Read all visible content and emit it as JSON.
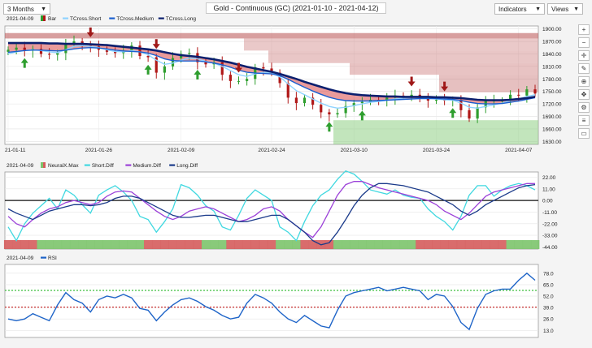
{
  "toolbar": {
    "range_label": "3 Months",
    "title": "Gold - Continuous (GC) (2021-01-10 - 2021-04-12)",
    "indicators_label": "Indicators",
    "views_label": "Views"
  },
  "side_tools": [
    "plus-icon",
    "minus-icon",
    "crosshair-icon",
    "draw-icon",
    "zoom-icon",
    "pan-icon",
    "settings-icon",
    "list-icon",
    "comment-icon"
  ],
  "colors": {
    "bar_up": "#2e9e2e",
    "bar_down": "#b01818",
    "tcross_short": "#8fd3ff",
    "tcross_medium": "#1a5fd0",
    "tcross_long": "#0b1f6e",
    "short_diff": "#40d8e0",
    "medium_diff": "#9b40d8",
    "long_diff": "#1a3a8a",
    "rsi": "#1e64c8",
    "up_arrow": "#2e9e2e",
    "down_arrow": "#a01818"
  },
  "chart_data": [
    {
      "type": "line",
      "panel": "price",
      "date_label": "2021-04-09",
      "legend": [
        "Bar",
        "TCross.Short",
        "TCross.Medium",
        "TCross.Long"
      ],
      "x": [
        "2021-01-11",
        "2021-01-12",
        "2021-01-13",
        "2021-01-14",
        "2021-01-15",
        "2021-01-18",
        "2021-01-19",
        "2021-01-20",
        "2021-01-21",
        "2021-01-22",
        "2021-01-25",
        "2021-01-26",
        "2021-01-27",
        "2021-01-28",
        "2021-01-29",
        "2021-02-01",
        "2021-02-02",
        "2021-02-03",
        "2021-02-04",
        "2021-02-05",
        "2021-02-08",
        "2021-02-09",
        "2021-02-10",
        "2021-02-11",
        "2021-02-12",
        "2021-02-15",
        "2021-02-16",
        "2021-02-17",
        "2021-02-18",
        "2021-02-19",
        "2021-02-22",
        "2021-02-23",
        "2021-02-24",
        "2021-02-25",
        "2021-02-26",
        "2021-03-01",
        "2021-03-02",
        "2021-03-03",
        "2021-03-04",
        "2021-03-05",
        "2021-03-08",
        "2021-03-09",
        "2021-03-10",
        "2021-03-11",
        "2021-03-12",
        "2021-03-15",
        "2021-03-16",
        "2021-03-17",
        "2021-03-18",
        "2021-03-19",
        "2021-03-22",
        "2021-03-23",
        "2021-03-24",
        "2021-03-25",
        "2021-03-26",
        "2021-03-29",
        "2021-03-30",
        "2021-03-31",
        "2021-04-01",
        "2021-04-02",
        "2021-04-05",
        "2021-04-06",
        "2021-04-07",
        "2021-04-08",
        "2021-04-09"
      ],
      "x_ticks": [
        "21-01-11",
        "2021-01-26",
        "2021-02-09",
        "2021-02-24",
        "2021-03-10",
        "2021-03-24",
        "2021-04-07"
      ],
      "x_tick_index": [
        0,
        11,
        21,
        32,
        42,
        52,
        62
      ],
      "close": [
        1850,
        1855,
        1848,
        1852,
        1840,
        1838,
        1842,
        1865,
        1870,
        1860,
        1858,
        1850,
        1845,
        1842,
        1848,
        1860,
        1835,
        1832,
        1795,
        1810,
        1830,
        1840,
        1842,
        1820,
        1815,
        1820,
        1790,
        1775,
        1775,
        1780,
        1808,
        1805,
        1795,
        1770,
        1735,
        1722,
        1735,
        1718,
        1700,
        1695,
        1698,
        1715,
        1722,
        1725,
        1730,
        1728,
        1735,
        1740,
        1738,
        1742,
        1738,
        1728,
        1730,
        1728,
        1730,
        1705,
        1685,
        1712,
        1728,
        1728,
        1728,
        1742,
        1740,
        1755,
        1745
      ],
      "series": [
        {
          "name": "TCross.Short",
          "values": [
            1840,
            1845,
            1848,
            1850,
            1848,
            1845,
            1843,
            1850,
            1858,
            1860,
            1858,
            1855,
            1850,
            1846,
            1845,
            1848,
            1845,
            1838,
            1825,
            1815,
            1818,
            1825,
            1830,
            1828,
            1822,
            1818,
            1810,
            1800,
            1790,
            1786,
            1792,
            1796,
            1795,
            1785,
            1768,
            1752,
            1742,
            1732,
            1722,
            1714,
            1710,
            1712,
            1716,
            1720,
            1724,
            1726,
            1729,
            1732,
            1734,
            1736,
            1736,
            1734,
            1732,
            1730,
            1729,
            1722,
            1712,
            1710,
            1714,
            1718,
            1722,
            1728,
            1732,
            1738,
            1742
          ]
        },
        {
          "name": "TCross.Medium",
          "values": [
            1844,
            1846,
            1848,
            1849,
            1849,
            1848,
            1847,
            1849,
            1852,
            1854,
            1855,
            1854,
            1852,
            1849,
            1847,
            1846,
            1845,
            1842,
            1836,
            1828,
            1824,
            1823,
            1823,
            1823,
            1821,
            1818,
            1814,
            1808,
            1801,
            1796,
            1794,
            1793,
            1792,
            1788,
            1779,
            1769,
            1760,
            1751,
            1743,
            1736,
            1731,
            1728,
            1727,
            1727,
            1727,
            1728,
            1729,
            1730,
            1731,
            1732,
            1733,
            1733,
            1733,
            1732,
            1731,
            1728,
            1724,
            1721,
            1720,
            1720,
            1721,
            1724,
            1727,
            1731,
            1735
          ]
        },
        {
          "name": "TCross.Long",
          "values": [
            1866,
            1866,
            1866,
            1866,
            1866,
            1865,
            1865,
            1864,
            1864,
            1864,
            1863,
            1862,
            1861,
            1859,
            1857,
            1855,
            1853,
            1851,
            1848,
            1844,
            1840,
            1837,
            1835,
            1833,
            1830,
            1827,
            1823,
            1819,
            1814,
            1809,
            1805,
            1801,
            1797,
            1792,
            1786,
            1780,
            1773,
            1767,
            1761,
            1755,
            1750,
            1746,
            1743,
            1741,
            1740,
            1739,
            1738,
            1738,
            1737,
            1737,
            1737,
            1737,
            1736,
            1736,
            1735,
            1734,
            1732,
            1730,
            1729,
            1729,
            1729,
            1730,
            1732,
            1734,
            1737
          ]
        }
      ],
      "y_ticks": [
        1900,
        1870,
        1840,
        1810,
        1780,
        1750,
        1720,
        1690,
        1660,
        1630
      ],
      "y_tick_labels": [
        "1900.00",
        "1870.00",
        "1840.00",
        "1810.00",
        "1780.00",
        "1750.00",
        "1720.00",
        "1690.00",
        "1660.00",
        "1630.00"
      ],
      "ylim": [
        1623,
        1907
      ],
      "down_arrows_at": [
        10,
        18,
        28,
        49,
        53
      ],
      "up_arrows_at": [
        2,
        17,
        23,
        39,
        43,
        54
      ]
    },
    {
      "type": "line",
      "panel": "neurals",
      "date_label": "2021-04-09",
      "legend": [
        "NeuralX.Max",
        "Short.Diff",
        "Medium.Diff",
        "Long.Diff"
      ],
      "series": [
        {
          "name": "Short.Diff",
          "values": [
            -25,
            -38,
            -22,
            -12,
            -5,
            2,
            -8,
            10,
            5,
            -4,
            -12,
            5,
            10,
            14,
            8,
            0,
            -15,
            -18,
            -30,
            -20,
            -8,
            15,
            12,
            5,
            -5,
            -10,
            -25,
            -28,
            -14,
            2,
            10,
            5,
            0,
            -25,
            -30,
            -38,
            -20,
            -5,
            5,
            10,
            20,
            28,
            25,
            18,
            10,
            8,
            6,
            10,
            5,
            3,
            2,
            -8,
            -15,
            -20,
            -28,
            -15,
            5,
            14,
            14,
            4,
            10,
            14,
            16,
            14,
            10
          ]
        },
        {
          "name": "Medium.Diff",
          "values": [
            -15,
            -22,
            -25,
            -18,
            -12,
            -8,
            -6,
            -2,
            0,
            -2,
            -4,
            -2,
            4,
            8,
            9,
            8,
            2,
            -4,
            -10,
            -15,
            -18,
            -15,
            -10,
            -8,
            -6,
            -8,
            -12,
            -16,
            -20,
            -18,
            -14,
            -8,
            -6,
            -10,
            -18,
            -24,
            -30,
            -35,
            -25,
            -10,
            5,
            15,
            18,
            18,
            15,
            12,
            10,
            8,
            6,
            4,
            2,
            0,
            -4,
            -10,
            -14,
            -18,
            -12,
            -4,
            4,
            8,
            10,
            12,
            14,
            16,
            16
          ]
        },
        {
          "name": "Long.Diff",
          "values": [
            -8,
            -12,
            -15,
            -18,
            -14,
            -10,
            -8,
            -6,
            -4,
            -4,
            -5,
            -4,
            -2,
            2,
            4,
            4,
            2,
            -2,
            -6,
            -10,
            -14,
            -16,
            -16,
            -15,
            -14,
            -14,
            -16,
            -18,
            -20,
            -20,
            -18,
            -16,
            -14,
            -14,
            -18,
            -24,
            -30,
            -38,
            -42,
            -40,
            -30,
            -18,
            -5,
            5,
            12,
            16,
            16,
            15,
            14,
            12,
            10,
            8,
            4,
            0,
            -4,
            -10,
            -14,
            -10,
            -4,
            0,
            4,
            8,
            12,
            14,
            15
          ]
        }
      ],
      "neural_max": [
        -1,
        -1,
        -1,
        -1,
        1,
        1,
        1,
        1,
        1,
        1,
        1,
        1,
        1,
        1,
        1,
        1,
        1,
        -1,
        -1,
        -1,
        -1,
        -1,
        -1,
        -1,
        1,
        1,
        1,
        -1,
        -1,
        -1,
        -1,
        -1,
        -1,
        1,
        1,
        1,
        -1,
        -1,
        -1,
        -1,
        1,
        1,
        1,
        1,
        1,
        1,
        1,
        1,
        1,
        1,
        -1,
        -1,
        -1,
        -1,
        -1,
        -1,
        -1,
        -1,
        -1,
        -1,
        -1,
        1,
        1,
        1,
        1
      ],
      "y_ticks": [
        22,
        11,
        0,
        -11,
        -22,
        -33,
        -44
      ],
      "y_tick_labels": [
        "22.00",
        "11.00",
        "0.00",
        "-11.00",
        "-22.00",
        "-33.00",
        "-44.00"
      ],
      "ylim": [
        -46,
        27
      ]
    },
    {
      "type": "line",
      "panel": "rsi",
      "date_label": "2021-04-09",
      "legend": [
        "RSI"
      ],
      "series": [
        {
          "name": "RSI",
          "values": [
            26,
            24,
            26,
            32,
            28,
            24,
            42,
            56,
            48,
            44,
            34,
            48,
            52,
            50,
            54,
            50,
            38,
            36,
            24,
            34,
            42,
            48,
            50,
            46,
            40,
            36,
            30,
            26,
            28,
            44,
            54,
            50,
            44,
            34,
            26,
            22,
            30,
            24,
            18,
            16,
            36,
            52,
            56,
            58,
            60,
            62,
            58,
            60,
            62,
            60,
            58,
            48,
            54,
            52,
            40,
            22,
            14,
            38,
            54,
            58,
            60,
            60,
            70,
            78,
            70
          ]
        }
      ],
      "reference_lines": [
        58.5,
        39.5
      ],
      "y_ticks": [
        78,
        65,
        52,
        39,
        26,
        13
      ],
      "y_tick_labels": [
        "78.0",
        "65.0",
        "52.0",
        "39.0",
        "26.0",
        "13.0"
      ],
      "ylim": [
        5,
        88
      ]
    }
  ]
}
